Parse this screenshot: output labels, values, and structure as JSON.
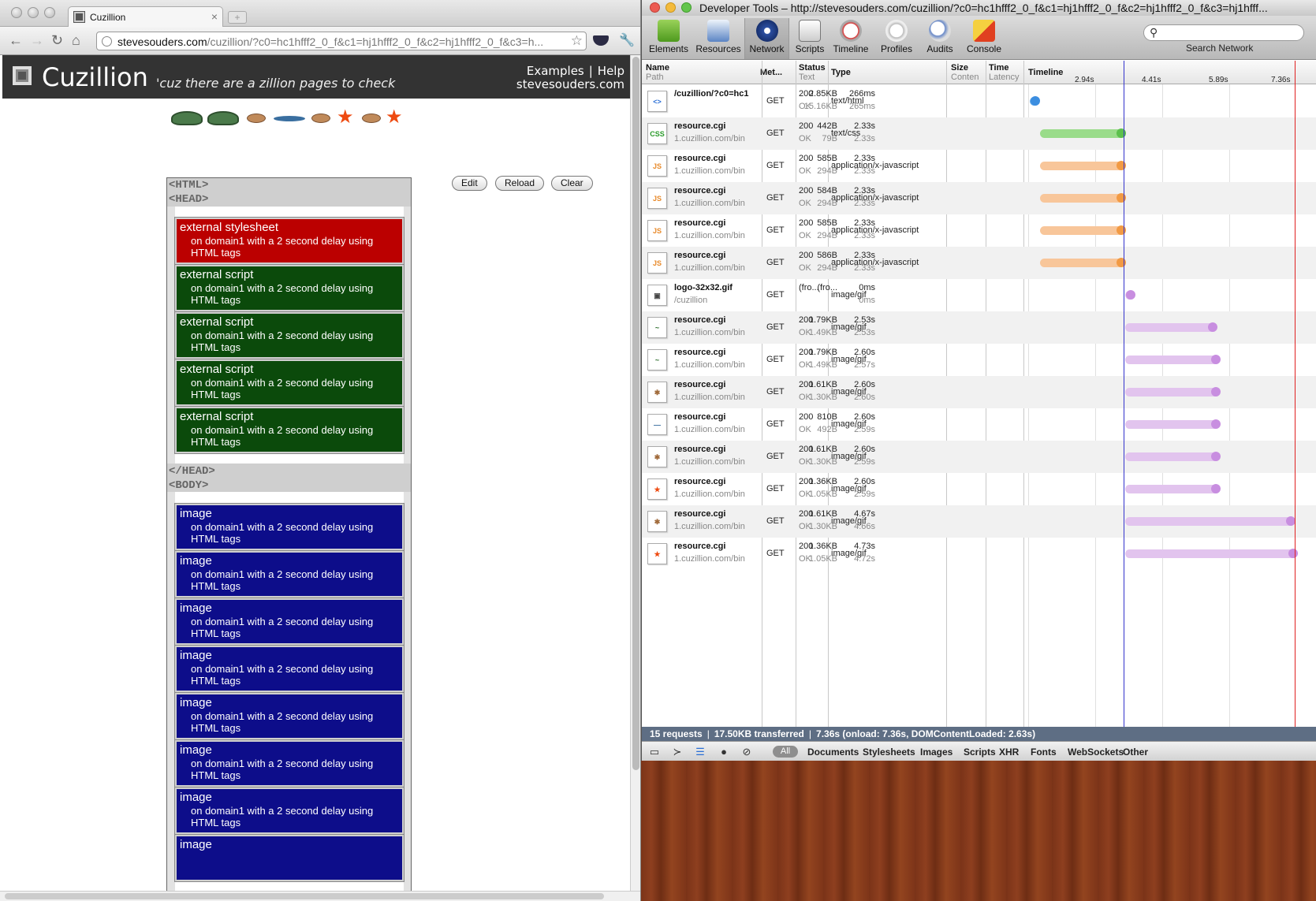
{
  "browser": {
    "tab_title": "Cuzillion",
    "url_host": "stevesouders.com",
    "url_path": "/cuzillion/?c0=hc1hfff2_0_f&c1=hj1hfff2_0_f&c2=hj1hfff2_0_f&c3=h..."
  },
  "cuzillion": {
    "title": "Cuzillion",
    "tagline": "'cuz there are a zillion pages to check",
    "links": {
      "examples": "Examples",
      "separator": "|",
      "help": "Help",
      "site": "stevesouders.com"
    },
    "buttons": {
      "edit": "Edit",
      "reload": "Reload",
      "clear": "Clear"
    },
    "tags": {
      "html_open": "<HTML>",
      "head_open": "<HEAD>",
      "head_close": "</HEAD>",
      "body_open": "<BODY>"
    },
    "head_resources": [
      {
        "title": "external stylesheet",
        "desc": "on domain1 with a 2 second delay using HTML tags",
        "color": "#bb0000"
      },
      {
        "title": "external script",
        "desc": "on domain1 with a 2 second delay using HTML tags",
        "color": "#0b4a0b"
      },
      {
        "title": "external script",
        "desc": "on domain1 with a 2 second delay using HTML tags",
        "color": "#0b4a0b"
      },
      {
        "title": "external script",
        "desc": "on domain1 with a 2 second delay using HTML tags",
        "color": "#0b4a0b"
      },
      {
        "title": "external script",
        "desc": "on domain1 with a 2 second delay using HTML tags",
        "color": "#0b4a0b"
      }
    ],
    "body_resources": [
      {
        "title": "image",
        "desc": "on domain1 with a 2 second delay using HTML tags"
      },
      {
        "title": "image",
        "desc": "on domain1 with a 2 second delay using HTML tags"
      },
      {
        "title": "image",
        "desc": "on domain1 with a 2 second delay using HTML tags"
      },
      {
        "title": "image",
        "desc": "on domain1 with a 2 second delay using HTML tags"
      },
      {
        "title": "image",
        "desc": "on domain1 with a 2 second delay using HTML tags"
      },
      {
        "title": "image",
        "desc": "on domain1 with a 2 second delay using HTML tags"
      },
      {
        "title": "image",
        "desc": "on domain1 with a 2 second delay using HTML tags"
      },
      {
        "title": "image",
        "desc": ""
      }
    ]
  },
  "devtools": {
    "window_title": "Developer Tools – http://stevesouders.com/cuzillion/?c0=hc1hfff2_0_f&c1=hj1hfff2_0_f&c2=hj1hfff2_0_f&c3=hj1hfff...",
    "tools": [
      "Elements",
      "Resources",
      "Network",
      "Scripts",
      "Timeline",
      "Profiles",
      "Audits",
      "Console"
    ],
    "active_tool": "Network",
    "search_label": "Search Network",
    "columns": {
      "name": "Name",
      "path": "Path",
      "method": "Met...",
      "status": "Status",
      "status_text": "Text",
      "type": "Type",
      "size": "Size",
      "content": "Conten",
      "time": "Time",
      "latency": "Latency",
      "timeline": "Timeline"
    },
    "ticks": [
      "2.94s",
      "4.41s",
      "5.89s",
      "7.36s"
    ],
    "requests": [
      {
        "icon": "html",
        "name": "/cuzillion/?c0=hc1",
        "path": "",
        "method": "GET",
        "status": "200",
        "status_text": "OK",
        "type": "text/html",
        "size": "2.85KB",
        "content": "15.16KB",
        "time": "266ms",
        "latency": "265ms",
        "start": 0.0,
        "end": 0.266,
        "color": "blue"
      },
      {
        "icon": "css",
        "name": "resource.cgi",
        "path": "1.cuzillion.com/bin",
        "method": "GET",
        "status": "200",
        "status_text": "OK",
        "type": "text/css",
        "size": "442B",
        "content": "79B",
        "time": "2.33s",
        "latency": "2.33s",
        "start": 0.28,
        "end": 2.61,
        "color": "green"
      },
      {
        "icon": "js",
        "name": "resource.cgi",
        "path": "1.cuzillion.com/bin",
        "method": "GET",
        "status": "200",
        "status_text": "OK",
        "type": "application/x-javascript",
        "size": "585B",
        "content": "294B",
        "time": "2.33s",
        "latency": "2.33s",
        "start": 0.28,
        "end": 2.61,
        "color": "orange"
      },
      {
        "icon": "js",
        "name": "resource.cgi",
        "path": "1.cuzillion.com/bin",
        "method": "GET",
        "status": "200",
        "status_text": "OK",
        "type": "application/x-javascript",
        "size": "584B",
        "content": "294B",
        "time": "2.33s",
        "latency": "2.33s",
        "start": 0.28,
        "end": 2.61,
        "color": "orange"
      },
      {
        "icon": "js",
        "name": "resource.cgi",
        "path": "1.cuzillion.com/bin",
        "method": "GET",
        "status": "200",
        "status_text": "OK",
        "type": "application/x-javascript",
        "size": "585B",
        "content": "294B",
        "time": "2.33s",
        "latency": "2.33s",
        "start": 0.28,
        "end": 2.61,
        "color": "orange"
      },
      {
        "icon": "js",
        "name": "resource.cgi",
        "path": "1.cuzillion.com/bin",
        "method": "GET",
        "status": "200",
        "status_text": "OK",
        "type": "application/x-javascript",
        "size": "586B",
        "content": "294B",
        "time": "2.33s",
        "latency": "2.33s",
        "start": 0.28,
        "end": 2.61,
        "color": "orange"
      },
      {
        "icon": "logo",
        "name": "logo-32x32.gif",
        "path": "/cuzillion",
        "method": "GET",
        "status": "(fro...",
        "status_text": "",
        "type": "image/gif",
        "size": "(fro...",
        "content": "",
        "time": "0ms",
        "latency": "0ms",
        "start": 2.61,
        "end": 2.61,
        "color": "purple"
      },
      {
        "icon": "turtle",
        "name": "resource.cgi",
        "path": "1.cuzillion.com/bin",
        "method": "GET",
        "status": "200",
        "status_text": "OK",
        "type": "image/gif",
        "size": "1.79KB",
        "content": "1.49KB",
        "time": "2.53s",
        "latency": "2.53s",
        "start": 2.61,
        "end": 5.14,
        "color": "purple"
      },
      {
        "icon": "turtle",
        "name": "resource.cgi",
        "path": "1.cuzillion.com/bin",
        "method": "GET",
        "status": "200",
        "status_text": "OK",
        "type": "image/gif",
        "size": "1.79KB",
        "content": "1.49KB",
        "time": "2.60s",
        "latency": "2.57s",
        "start": 2.61,
        "end": 5.21,
        "color": "purple"
      },
      {
        "icon": "crab",
        "name": "resource.cgi",
        "path": "1.cuzillion.com/bin",
        "method": "GET",
        "status": "200",
        "status_text": "OK",
        "type": "image/gif",
        "size": "1.61KB",
        "content": "1.30KB",
        "time": "2.60s",
        "latency": "2.60s",
        "start": 2.61,
        "end": 5.21,
        "color": "purple"
      },
      {
        "icon": "fish",
        "name": "resource.cgi",
        "path": "1.cuzillion.com/bin",
        "method": "GET",
        "status": "200",
        "status_text": "OK",
        "type": "image/gif",
        "size": "810B",
        "content": "492B",
        "time": "2.60s",
        "latency": "2.59s",
        "start": 2.61,
        "end": 5.21,
        "color": "purple"
      },
      {
        "icon": "crab",
        "name": "resource.cgi",
        "path": "1.cuzillion.com/bin",
        "method": "GET",
        "status": "200",
        "status_text": "OK",
        "type": "image/gif",
        "size": "1.61KB",
        "content": "1.30KB",
        "time": "2.60s",
        "latency": "2.59s",
        "start": 2.61,
        "end": 5.21,
        "color": "purple"
      },
      {
        "icon": "star",
        "name": "resource.cgi",
        "path": "1.cuzillion.com/bin",
        "method": "GET",
        "status": "200",
        "status_text": "OK",
        "type": "image/gif",
        "size": "1.36KB",
        "content": "1.05KB",
        "time": "2.60s",
        "latency": "2.59s",
        "start": 2.61,
        "end": 5.21,
        "color": "purple"
      },
      {
        "icon": "crab",
        "name": "resource.cgi",
        "path": "1.cuzillion.com/bin",
        "method": "GET",
        "status": "200",
        "status_text": "OK",
        "type": "image/gif",
        "size": "1.61KB",
        "content": "1.30KB",
        "time": "4.67s",
        "latency": "4.66s",
        "start": 2.61,
        "end": 7.28,
        "color": "purple"
      },
      {
        "icon": "star",
        "name": "resource.cgi",
        "path": "1.cuzillion.com/bin",
        "method": "GET",
        "status": "200",
        "status_text": "OK",
        "type": "image/gif",
        "size": "1.36KB",
        "content": "1.05KB",
        "time": "4.73s",
        "latency": "4.72s",
        "start": 2.61,
        "end": 7.34,
        "color": "purple"
      }
    ],
    "timeline_range_s": 7.36,
    "dom_content_loaded_s": 2.63,
    "onload_s": 7.36,
    "summary": {
      "requests": "15 requests",
      "transferred": "17.50KB transferred",
      "timing": "7.36s (onload: 7.36s, DOMContentLoaded: 2.63s)"
    },
    "filters": [
      "All",
      "Documents",
      "Stylesheets",
      "Images",
      "Scripts",
      "XHR",
      "Fonts",
      "WebSockets",
      "Other"
    ],
    "bar_colors": {
      "blue": "#6aaeea",
      "green": "#9adc8a",
      "orange": "#f8c69a",
      "purple": "#e2c4ee"
    },
    "cap_colors": {
      "blue": "#3c8ee0",
      "green": "#5cc04c",
      "orange": "#f29a44",
      "purple": "#c88ee0"
    }
  }
}
